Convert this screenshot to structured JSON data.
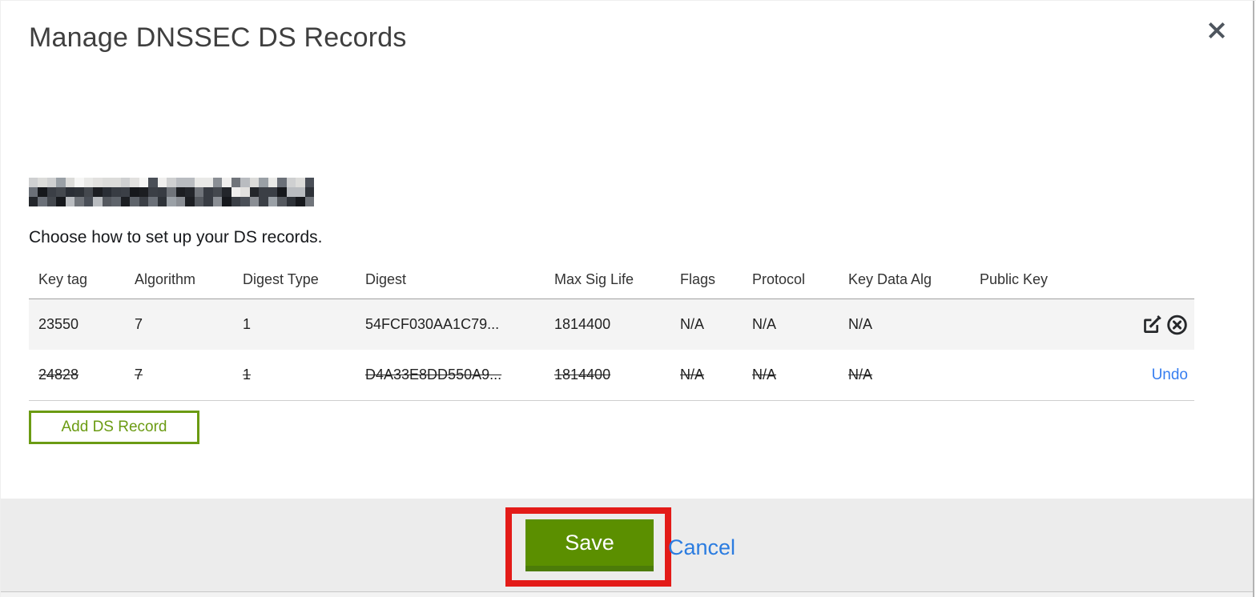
{
  "modal": {
    "title": "Manage DNSSEC DS Records",
    "subtitle": "Choose how to set up your DS records.",
    "domain": {
      "redacted": true
    }
  },
  "table": {
    "headers": {
      "key_tag": "Key tag",
      "algorithm": "Algorithm",
      "digest_type": "Digest Type",
      "digest": "Digest",
      "max_sig_life": "Max Sig Life",
      "flags": "Flags",
      "protocol": "Protocol",
      "key_data_alg": "Key Data Alg",
      "public_key": "Public Key"
    },
    "rows": [
      {
        "key_tag": "23550",
        "algorithm": "7",
        "digest_type": "1",
        "digest": "54FCF030AA1C79...",
        "max_sig_life": "1814400",
        "flags": "N/A",
        "protocol": "N/A",
        "key_data_alg": "N/A",
        "public_key": "",
        "state": "normal",
        "actions": [
          "edit",
          "delete"
        ]
      },
      {
        "key_tag": "24828",
        "algorithm": "7",
        "digest_type": "1",
        "digest": "D4A33E8DD550A9...",
        "max_sig_life": "1814400",
        "flags": "N/A",
        "protocol": "N/A",
        "key_data_alg": "N/A",
        "public_key": "",
        "state": "deleted",
        "undo_label": "Undo"
      }
    ]
  },
  "buttons": {
    "add_ds_record": "Add DS Record",
    "save": "Save",
    "cancel": "Cancel"
  },
  "colors": {
    "green_button": "#5b8f00",
    "green_button_border": "#4c7c09",
    "green_outline": "#6b9b13",
    "link_blue": "#2b7ce0",
    "undo_blue": "#377ef0",
    "annotation_red": "#e31b18",
    "footer_gray": "#ececec",
    "row_gray": "#f4f4f4",
    "icon_dark": "#26282b",
    "close_icon": "#4e555e"
  },
  "redaction_palette": {
    "light": [
      "#f6f6f5",
      "#e9e9e7",
      "#dcdcda",
      "#f0efee",
      "#cfd0d1",
      "#e2e1df"
    ],
    "dark": [
      "#2e3238",
      "#23262b",
      "#3b3f46",
      "#1c1e22",
      "#44484e",
      "#2a2e35",
      "#383c43",
      "#16181c"
    ],
    "mid": [
      "#8a8e94",
      "#6b7078",
      "#55595f",
      "#9aa0a6",
      "#70747a",
      "#b9bcc0",
      "#4a4f57",
      "#5f646b"
    ]
  }
}
